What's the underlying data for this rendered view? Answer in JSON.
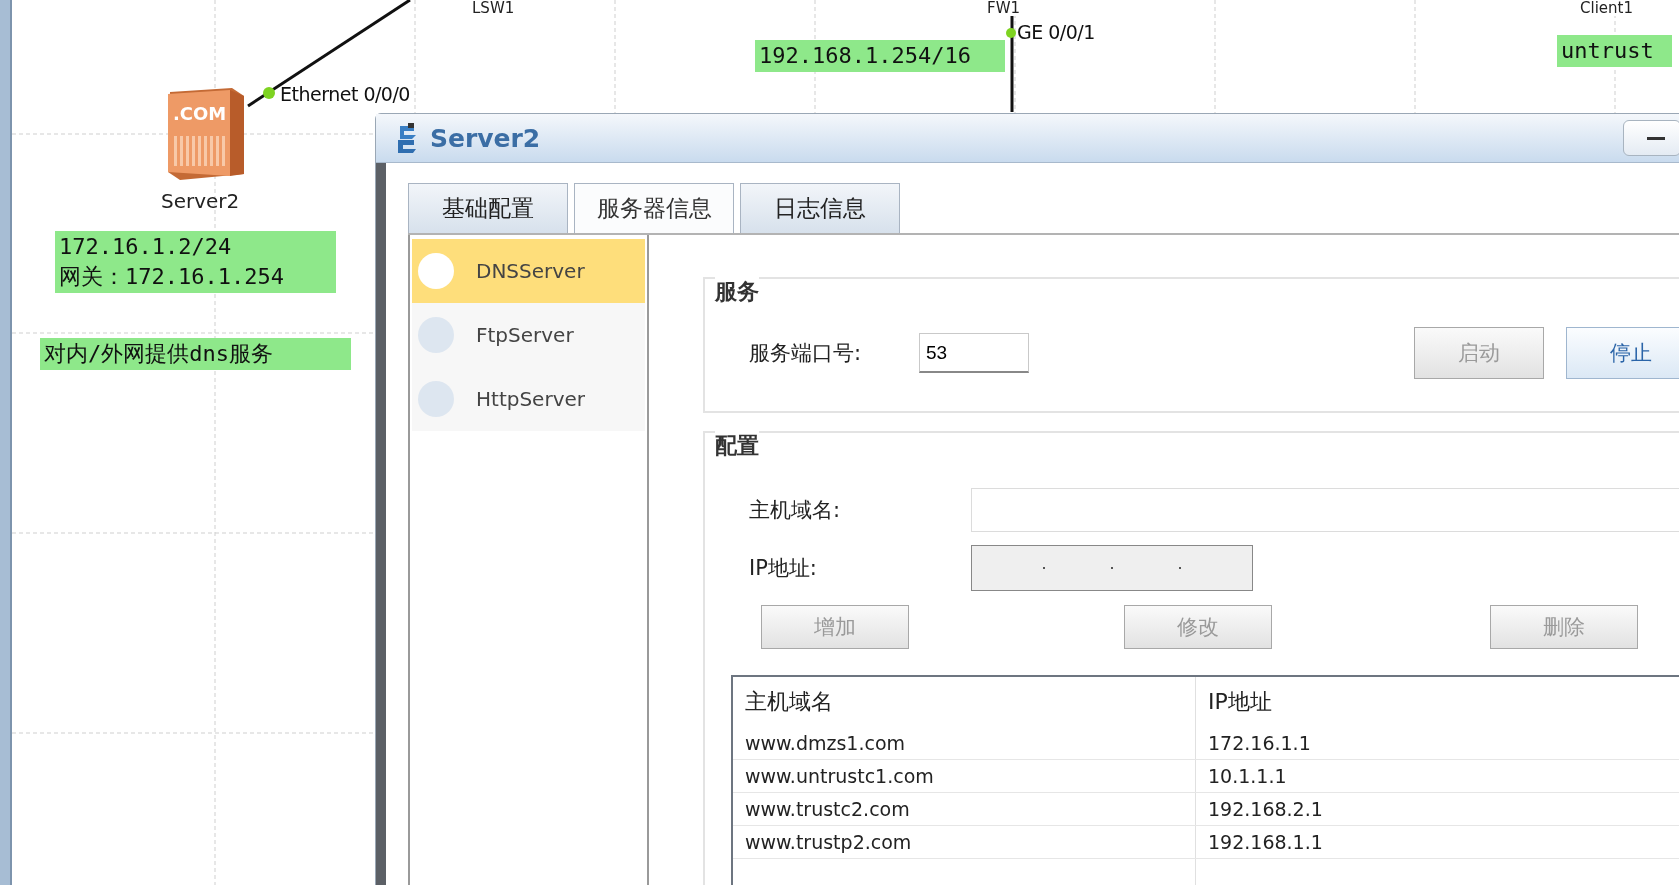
{
  "topology": {
    "device_labels": [
      "LSW1",
      "FW1",
      "Client1"
    ],
    "server": {
      "name": "Server2",
      "icon_text": ".COM"
    },
    "port_labels": [
      "Ethernet 0/0/0",
      "GE 0/0/1"
    ],
    "notes": [
      {
        "lines": [
          "172.16.1.2/24",
          "网关：172.16.1.254"
        ]
      },
      {
        "lines": [
          "对内/外网提供dns服务"
        ]
      },
      {
        "lines": [
          "192.168.1.254/16"
        ]
      },
      {
        "lines": [
          "untrust"
        ]
      }
    ]
  },
  "dialog": {
    "title": "Server2",
    "tabs": [
      {
        "label": "基础配置",
        "selected": false
      },
      {
        "label": "服务器信息",
        "selected": true
      },
      {
        "label": "日志信息",
        "selected": false
      }
    ],
    "services": [
      {
        "label": "DNSServer",
        "selected": true
      },
      {
        "label": "FtpServer",
        "selected": false
      },
      {
        "label": "HttpServer",
        "selected": false
      }
    ],
    "service_group": {
      "title": "服务",
      "port_label": "服务端口号:",
      "port_value": "53",
      "buttons": [
        {
          "label": "启动",
          "disabled": true
        },
        {
          "label": "停止",
          "disabled": false
        }
      ]
    },
    "config_group": {
      "title": "配置",
      "host_label": "主机域名:",
      "ip_label": "IP地址:",
      "buttons": [
        {
          "label": "增加",
          "disabled": true
        },
        {
          "label": "修改",
          "disabled": true
        },
        {
          "label": "删除",
          "disabled": true
        }
      ],
      "table": {
        "columns": [
          "主机域名",
          "IP地址"
        ],
        "rows": [
          [
            "www.dmzs1.com",
            "172.16.1.1"
          ],
          [
            "www.untrustc1.com",
            "10.1.1.1"
          ],
          [
            "www.trustc2.com",
            "192.168.2.1"
          ],
          [
            "www.trustp2.com",
            "192.168.1.1"
          ]
        ]
      }
    }
  }
}
